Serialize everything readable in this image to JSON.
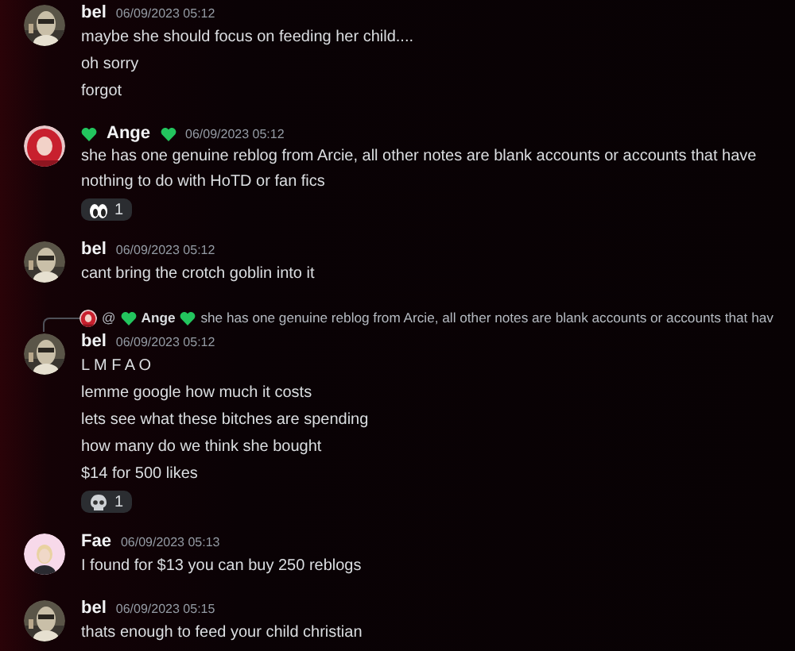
{
  "messages": [
    {
      "author": "bel",
      "decorated": false,
      "timestamp": "06/09/2023 05:12",
      "lines": [
        "maybe she should focus on feeding her child....",
        "oh sorry",
        "forgot"
      ]
    },
    {
      "author": "Ange",
      "decorated": true,
      "timestamp": "06/09/2023 05:12",
      "lines": [
        "she has one genuine reblog from Arcie, all other notes are blank accounts or accounts that have nothing to do with HoTD or fan fics"
      ],
      "reactions": [
        {
          "kind": "eyes",
          "count": "1"
        }
      ]
    },
    {
      "author": "bel",
      "decorated": false,
      "timestamp": "06/09/2023 05:12",
      "lines": [
        "cant bring the crotch goblin into it"
      ]
    },
    {
      "author": "bel",
      "decorated": false,
      "timestamp": "06/09/2023 05:12",
      "reply": {
        "mention": "@",
        "author": "Ange",
        "decorated": true,
        "text": "she has one genuine reblog from Arcie, all other notes are blank accounts or accounts that hav"
      },
      "lines": [
        "L M F A O",
        "lemme google how much it costs",
        "lets see what these bitches are spending",
        "how many do we think she bought",
        "$14 for 500 likes"
      ],
      "reactions": [
        {
          "kind": "skull",
          "count": "1"
        }
      ]
    },
    {
      "author": "Fae",
      "decorated": false,
      "timestamp": "06/09/2023 05:13",
      "lines": [
        "I found for $13 you can buy 250 reblogs"
      ]
    },
    {
      "author": "bel",
      "decorated": false,
      "timestamp": "06/09/2023 05:15",
      "lines": [
        "thats enough to feed your child christian"
      ]
    }
  ]
}
